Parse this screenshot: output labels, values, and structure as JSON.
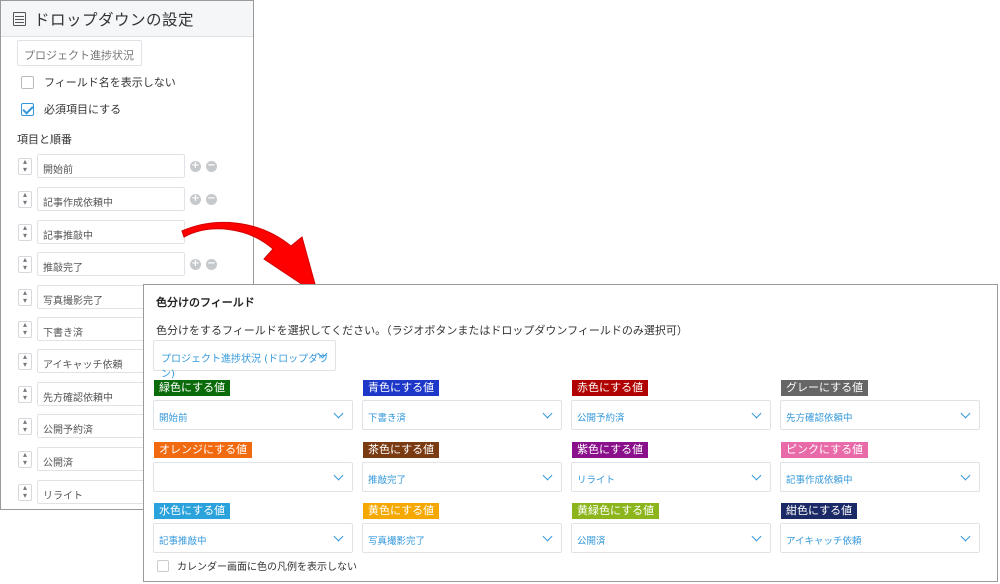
{
  "left": {
    "title": "ドロップダウンの設定",
    "field_name": "プロジェクト進捗状況",
    "hide_field_name_label": "フィールド名を表示しない",
    "required_label": "必須項目にする",
    "items_section_label": "項目と順番",
    "items": [
      "開始前",
      "記事作成依頼中",
      "記事推敲中",
      "推敲完了",
      "写真撮影完了",
      "下書き済",
      "アイキャッチ依頼",
      "先方確認依頼中",
      "公開予約済",
      "公開済",
      "リライト"
    ]
  },
  "right": {
    "title": "色分けのフィールド",
    "description": "色分けをするフィールドを選択してください。（ラジオボタンまたはドロップダウンフィールドのみ選択可）",
    "field_select_value": "プロジェクト進捗状況 (ドロップダウン)",
    "colors": [
      {
        "label": "緑色にする値",
        "color": "#0a6b0a",
        "value": "開始前"
      },
      {
        "label": "青色にする値",
        "color": "#1d38c9",
        "value": "下書き済"
      },
      {
        "label": "赤色にする値",
        "color": "#b00000",
        "value": "公開予約済"
      },
      {
        "label": "グレーにする値",
        "color": "#666666",
        "value": "先方確認依頼中"
      },
      {
        "label": "オレンジにする値",
        "color": "#f26a10",
        "value": ""
      },
      {
        "label": "茶色にする値",
        "color": "#7a3a12",
        "value": "推敲完了"
      },
      {
        "label": "紫色にする値",
        "color": "#8a0f8a",
        "value": "リライト"
      },
      {
        "label": "ピンクにする値",
        "color": "#e86aa8",
        "value": "記事作成依頼中"
      },
      {
        "label": "水色にする値",
        "color": "#2aa2dc",
        "value": "記事推敲中"
      },
      {
        "label": "黄色にする値",
        "color": "#f5a800",
        "value": "写真撮影完了"
      },
      {
        "label": "黄緑色にする値",
        "color": "#8bb51a",
        "value": "公開済"
      },
      {
        "label": "紺色にする値",
        "color": "#1b2a66",
        "value": "アイキャッチ依頼"
      }
    ],
    "legend_hide_label": "カレンダー画面に色の凡例を表示しない"
  },
  "accent_color": "#3498db",
  "arrow_color": "#ff0000"
}
